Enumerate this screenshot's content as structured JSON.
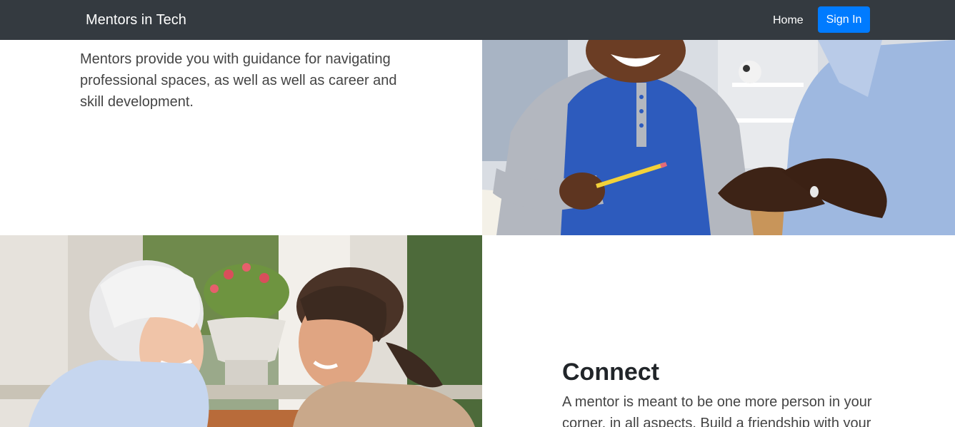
{
  "navbar": {
    "brand": "Mentors in Tech",
    "home_label": "Home",
    "signin_label": "Sign In"
  },
  "section_one": {
    "body": "Mentors provide you with guidance for navigating professional spaces, as well as well as career and skill development."
  },
  "section_two": {
    "heading": "Connect",
    "body": "A mentor is meant to be one more person in your corner, in all aspects. Build a friendship with your"
  },
  "colors": {
    "navbar_bg": "#343a40",
    "signin_bg": "#007bff",
    "text": "#212529",
    "body_text": "#444444"
  },
  "images": {
    "photo_one": "student-mentor-studying-photo",
    "photo_two": "two-women-talking-photo"
  }
}
